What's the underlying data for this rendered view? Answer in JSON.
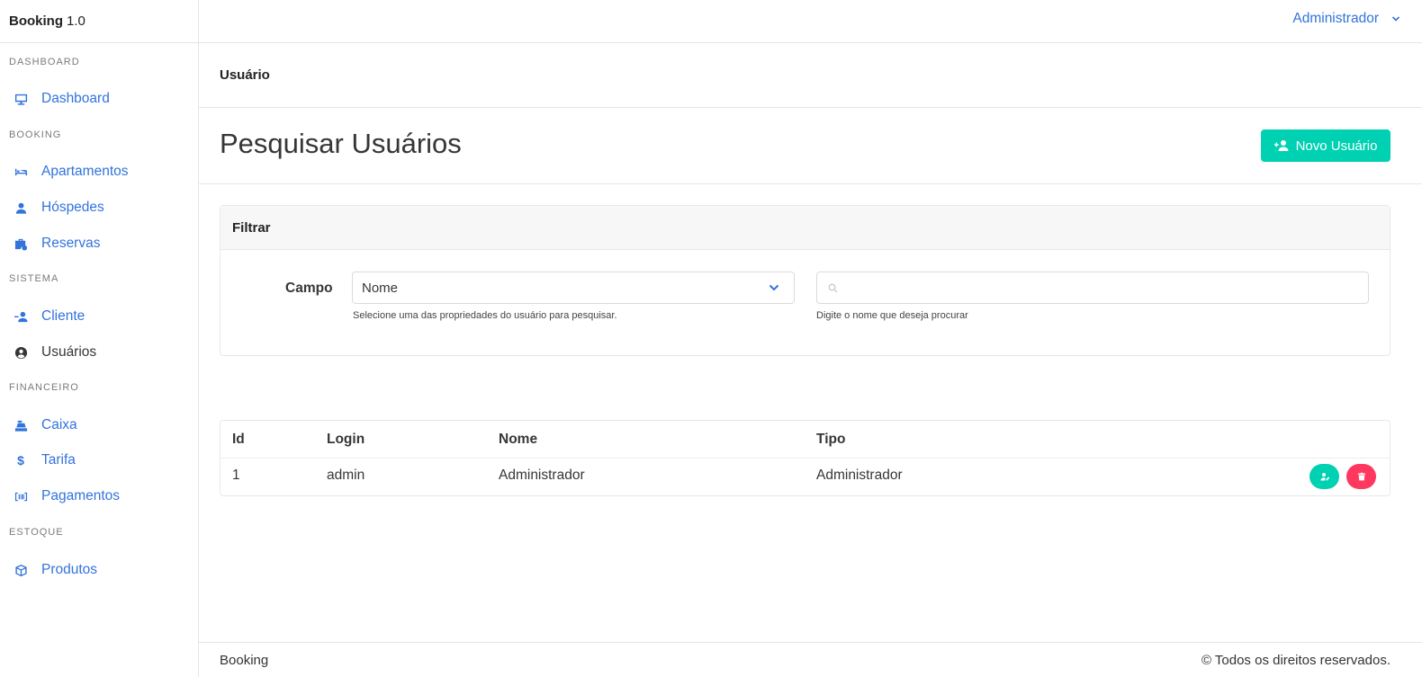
{
  "brand": {
    "name": "Booking",
    "version": "1.0"
  },
  "sidebar": {
    "sections": [
      "DASHBOARD",
      "BOOKING",
      "SISTEMA",
      "FINANCEIRO",
      "ESTOQUE"
    ],
    "items": [
      {
        "label": "Dashboard",
        "icon": "monitor-icon"
      },
      {
        "label": "Apartamentos",
        "icon": "bed-icon"
      },
      {
        "label": "Hóspedes",
        "icon": "user-icon"
      },
      {
        "label": "Reservas",
        "icon": "suitcase-clock-icon"
      },
      {
        "label": "Cliente",
        "icon": "user-plus-icon"
      },
      {
        "label": "Usuários",
        "icon": "user-circle-icon",
        "active": true
      },
      {
        "label": "Caixa",
        "icon": "cash-register-icon"
      },
      {
        "label": "Tarifa",
        "icon": "dollar-icon"
      },
      {
        "label": "Pagamentos",
        "icon": "barcode-icon"
      },
      {
        "label": "Produtos",
        "icon": "box-icon"
      }
    ]
  },
  "topbar": {
    "user": "Administrador"
  },
  "breadcrumb": "Usuário",
  "page": {
    "title": "Pesquisar Usuários",
    "new_button": "Novo Usuário"
  },
  "filter": {
    "title": "Filtrar",
    "field_label": "Campo",
    "select_value": "Nome",
    "select_help": "Selecione uma das propriedades do usuário para pesquisar.",
    "search_value": "",
    "search_placeholder": "",
    "search_help": "Digite o nome que deseja procurar"
  },
  "table": {
    "headers": [
      "Id",
      "Login",
      "Nome",
      "Tipo"
    ],
    "rows": [
      {
        "id": "1",
        "login": "admin",
        "nome": "Administrador",
        "tipo": "Administrador"
      }
    ]
  },
  "footer": {
    "left": "Booking",
    "right": "© Todos os direitos reservados."
  },
  "colors": {
    "primary": "#3273dc",
    "success": "#00d1b2",
    "danger": "#ff3860"
  }
}
